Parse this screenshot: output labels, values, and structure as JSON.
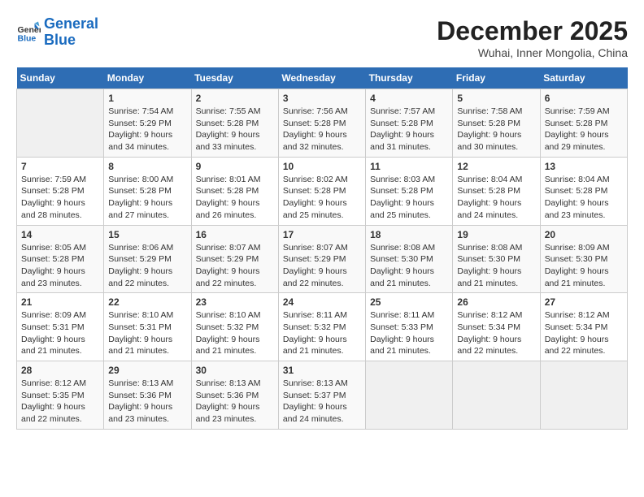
{
  "header": {
    "logo_line1": "General",
    "logo_line2": "Blue",
    "month_year": "December 2025",
    "location": "Wuhai, Inner Mongolia, China"
  },
  "weekdays": [
    "Sunday",
    "Monday",
    "Tuesday",
    "Wednesday",
    "Thursday",
    "Friday",
    "Saturday"
  ],
  "weeks": [
    [
      {
        "day": "",
        "info": ""
      },
      {
        "day": "1",
        "info": "Sunrise: 7:54 AM\nSunset: 5:29 PM\nDaylight: 9 hours\nand 34 minutes."
      },
      {
        "day": "2",
        "info": "Sunrise: 7:55 AM\nSunset: 5:28 PM\nDaylight: 9 hours\nand 33 minutes."
      },
      {
        "day": "3",
        "info": "Sunrise: 7:56 AM\nSunset: 5:28 PM\nDaylight: 9 hours\nand 32 minutes."
      },
      {
        "day": "4",
        "info": "Sunrise: 7:57 AM\nSunset: 5:28 PM\nDaylight: 9 hours\nand 31 minutes."
      },
      {
        "day": "5",
        "info": "Sunrise: 7:58 AM\nSunset: 5:28 PM\nDaylight: 9 hours\nand 30 minutes."
      },
      {
        "day": "6",
        "info": "Sunrise: 7:59 AM\nSunset: 5:28 PM\nDaylight: 9 hours\nand 29 minutes."
      }
    ],
    [
      {
        "day": "7",
        "info": "Sunrise: 7:59 AM\nSunset: 5:28 PM\nDaylight: 9 hours\nand 28 minutes."
      },
      {
        "day": "8",
        "info": "Sunrise: 8:00 AM\nSunset: 5:28 PM\nDaylight: 9 hours\nand 27 minutes."
      },
      {
        "day": "9",
        "info": "Sunrise: 8:01 AM\nSunset: 5:28 PM\nDaylight: 9 hours\nand 26 minutes."
      },
      {
        "day": "10",
        "info": "Sunrise: 8:02 AM\nSunset: 5:28 PM\nDaylight: 9 hours\nand 25 minutes."
      },
      {
        "day": "11",
        "info": "Sunrise: 8:03 AM\nSunset: 5:28 PM\nDaylight: 9 hours\nand 25 minutes."
      },
      {
        "day": "12",
        "info": "Sunrise: 8:04 AM\nSunset: 5:28 PM\nDaylight: 9 hours\nand 24 minutes."
      },
      {
        "day": "13",
        "info": "Sunrise: 8:04 AM\nSunset: 5:28 PM\nDaylight: 9 hours\nand 23 minutes."
      }
    ],
    [
      {
        "day": "14",
        "info": "Sunrise: 8:05 AM\nSunset: 5:28 PM\nDaylight: 9 hours\nand 23 minutes."
      },
      {
        "day": "15",
        "info": "Sunrise: 8:06 AM\nSunset: 5:29 PM\nDaylight: 9 hours\nand 22 minutes."
      },
      {
        "day": "16",
        "info": "Sunrise: 8:07 AM\nSunset: 5:29 PM\nDaylight: 9 hours\nand 22 minutes."
      },
      {
        "day": "17",
        "info": "Sunrise: 8:07 AM\nSunset: 5:29 PM\nDaylight: 9 hours\nand 22 minutes."
      },
      {
        "day": "18",
        "info": "Sunrise: 8:08 AM\nSunset: 5:30 PM\nDaylight: 9 hours\nand 21 minutes."
      },
      {
        "day": "19",
        "info": "Sunrise: 8:08 AM\nSunset: 5:30 PM\nDaylight: 9 hours\nand 21 minutes."
      },
      {
        "day": "20",
        "info": "Sunrise: 8:09 AM\nSunset: 5:30 PM\nDaylight: 9 hours\nand 21 minutes."
      }
    ],
    [
      {
        "day": "21",
        "info": "Sunrise: 8:09 AM\nSunset: 5:31 PM\nDaylight: 9 hours\nand 21 minutes."
      },
      {
        "day": "22",
        "info": "Sunrise: 8:10 AM\nSunset: 5:31 PM\nDaylight: 9 hours\nand 21 minutes."
      },
      {
        "day": "23",
        "info": "Sunrise: 8:10 AM\nSunset: 5:32 PM\nDaylight: 9 hours\nand 21 minutes."
      },
      {
        "day": "24",
        "info": "Sunrise: 8:11 AM\nSunset: 5:32 PM\nDaylight: 9 hours\nand 21 minutes."
      },
      {
        "day": "25",
        "info": "Sunrise: 8:11 AM\nSunset: 5:33 PM\nDaylight: 9 hours\nand 21 minutes."
      },
      {
        "day": "26",
        "info": "Sunrise: 8:12 AM\nSunset: 5:34 PM\nDaylight: 9 hours\nand 22 minutes."
      },
      {
        "day": "27",
        "info": "Sunrise: 8:12 AM\nSunset: 5:34 PM\nDaylight: 9 hours\nand 22 minutes."
      }
    ],
    [
      {
        "day": "28",
        "info": "Sunrise: 8:12 AM\nSunset: 5:35 PM\nDaylight: 9 hours\nand 22 minutes."
      },
      {
        "day": "29",
        "info": "Sunrise: 8:13 AM\nSunset: 5:36 PM\nDaylight: 9 hours\nand 23 minutes."
      },
      {
        "day": "30",
        "info": "Sunrise: 8:13 AM\nSunset: 5:36 PM\nDaylight: 9 hours\nand 23 minutes."
      },
      {
        "day": "31",
        "info": "Sunrise: 8:13 AM\nSunset: 5:37 PM\nDaylight: 9 hours\nand 24 minutes."
      },
      {
        "day": "",
        "info": ""
      },
      {
        "day": "",
        "info": ""
      },
      {
        "day": "",
        "info": ""
      }
    ]
  ]
}
